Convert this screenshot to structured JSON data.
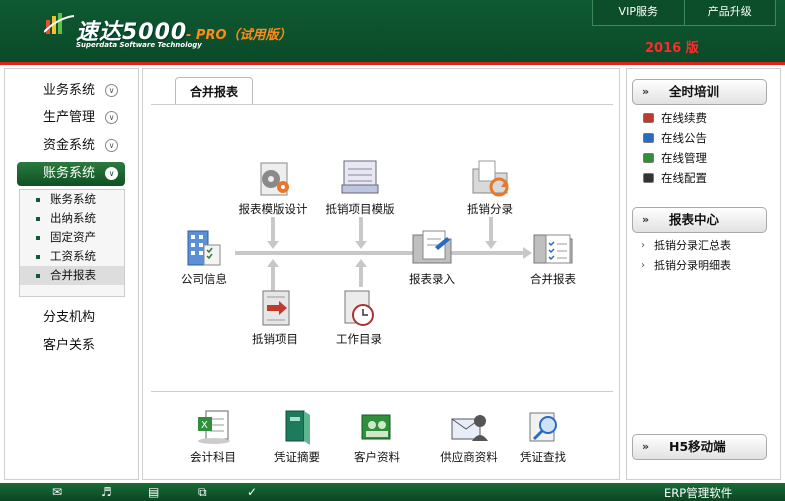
{
  "header": {
    "logo": "速达5000",
    "edition": "- PRO（试用版）",
    "tagline": "Superdata Software Technology",
    "year": "2016 版",
    "top_buttons": [
      "VIP服务",
      "产品升级"
    ]
  },
  "sidebar": {
    "menus": [
      "业务系统",
      "生产管理",
      "资金系统",
      "账务系统",
      "分支机构",
      "客户关系"
    ],
    "active_menu": "账务系统",
    "submenu": [
      "账务系统",
      "出纳系统",
      "固定资产",
      "工资系统",
      "合并报表"
    ],
    "selected_submenu": "合并报表"
  },
  "main": {
    "tab": "合并报表",
    "flow": {
      "report_template": "报表模版设计",
      "offset_template": "抵销项目模版",
      "offset_entry": "抵销分录",
      "company_info": "公司信息",
      "report_entry": "报表录入",
      "consolidated_report": "合并报表",
      "offset_item": "抵销项目",
      "work_catalog": "工作目录"
    },
    "shortcuts": [
      "会计科目",
      "凭证摘要",
      "客户资料",
      "供应商资料",
      "凭证查找"
    ]
  },
  "right": {
    "training": {
      "title": "全时培训",
      "items": [
        "在线续费",
        "在线公告",
        "在线管理",
        "在线配置"
      ],
      "item_colors": [
        "#c0392b",
        "#2a6ac0",
        "#2f8f3a",
        "#333333"
      ]
    },
    "report_center": {
      "title": "报表中心",
      "items": [
        "抵销分录汇总表",
        "抵销分录明细表"
      ]
    },
    "mobile": {
      "title": "H5移动端"
    }
  },
  "footer": {
    "label": "ERP管理软件",
    "icons": [
      "mail-icon",
      "speaker-icon",
      "book-icon",
      "copy-icon",
      "check-icon"
    ]
  }
}
